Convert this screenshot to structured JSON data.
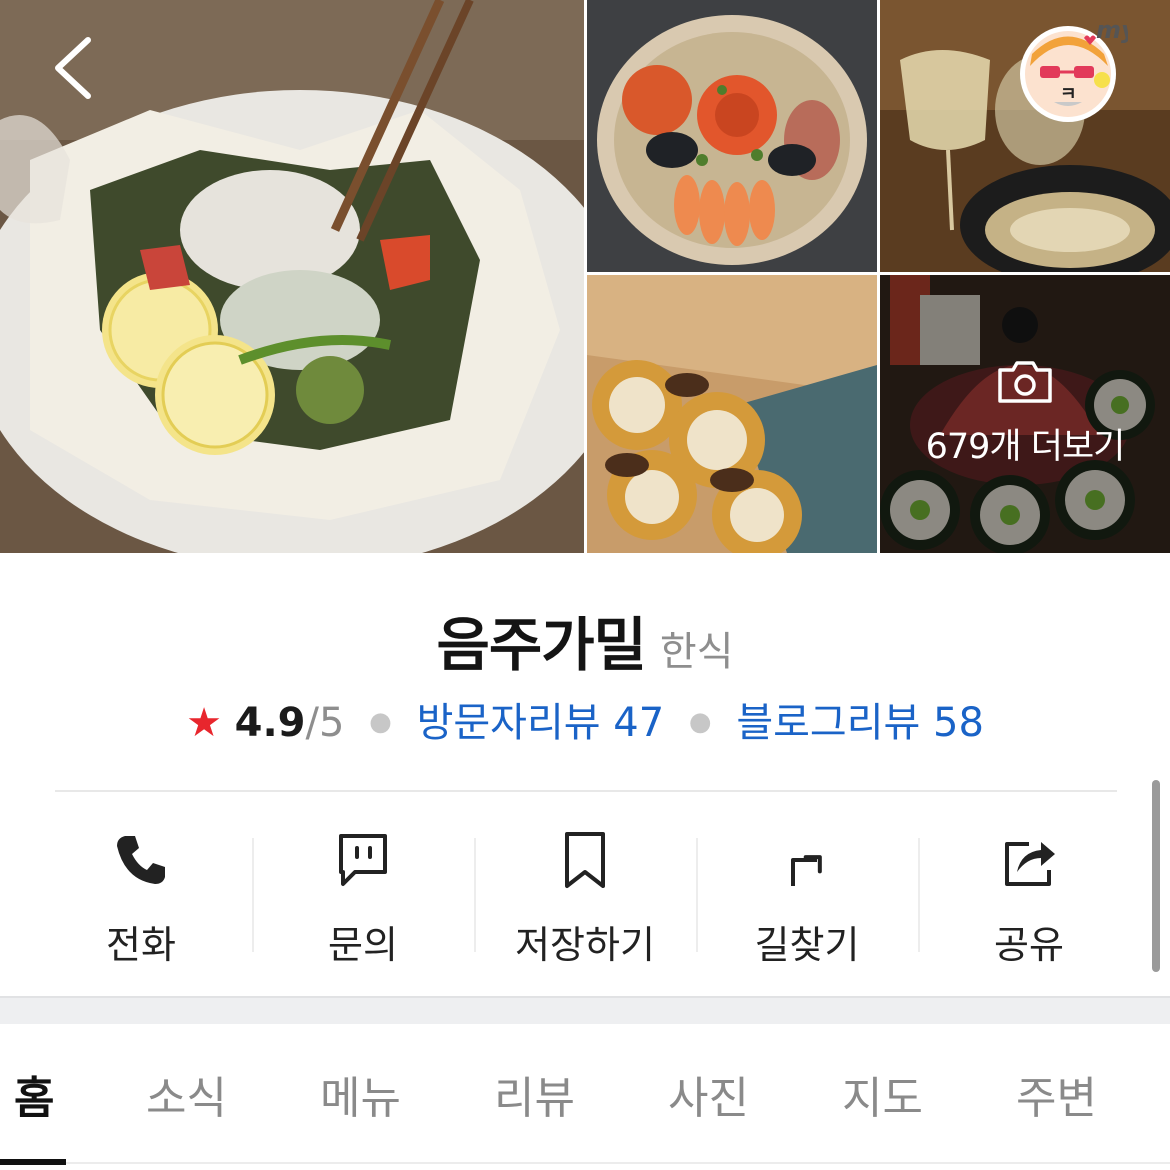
{
  "header": {
    "back_icon": "chevron-left-icon",
    "avatar_badge": "my",
    "avatar_glyph": "ㅋ"
  },
  "gallery": {
    "photos": [
      "paper-baked fish",
      "seafood platter",
      "wine and pot rice",
      "shiitake croquettes",
      "beef tartare gimbap"
    ],
    "more_icon": "camera-icon",
    "more_label": "679개 더보기"
  },
  "place": {
    "name": "음주가밀",
    "category": "한식",
    "rating_star": "★",
    "rating": "4.9",
    "rating_max": "/5",
    "visitor_reviews": "방문자리뷰 47",
    "blog_reviews": "블로그리뷰 58"
  },
  "actions": [
    {
      "label": "전화",
      "icon": "phone-icon"
    },
    {
      "label": "문의",
      "icon": "chat-icon"
    },
    {
      "label": "저장하기",
      "icon": "bookmark-icon"
    },
    {
      "label": "길찾기",
      "icon": "directions-icon"
    },
    {
      "label": "공유",
      "icon": "share-icon"
    }
  ],
  "tabs": [
    {
      "label": "홈",
      "active": true
    },
    {
      "label": "소식"
    },
    {
      "label": "메뉴"
    },
    {
      "label": "리뷰"
    },
    {
      "label": "사진"
    },
    {
      "label": "지도"
    },
    {
      "label": "주변"
    }
  ],
  "colors": {
    "star": "#e8262d",
    "link": "#1a63c7",
    "muted": "#8e8e8e",
    "active_tab": "#111111"
  }
}
